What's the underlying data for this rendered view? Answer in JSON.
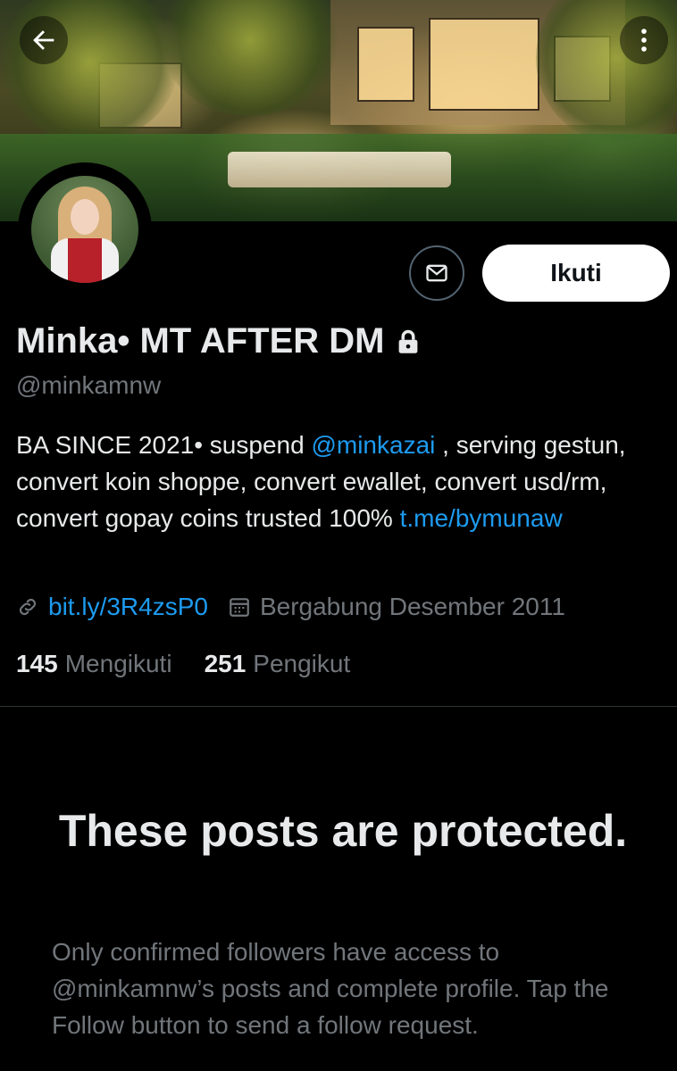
{
  "profile": {
    "display_name": "Minka• MT AFTER DM",
    "handle": "@minkamnw",
    "bio": {
      "part1": "BA SINCE 2021• suspend ",
      "mention": "@minkazai",
      "part2": " , serving gestun, convert koin shoppe, convert ewallet, convert usd/rm, convert gopay coins trusted 100% ",
      "link": "t.me/bymunaw"
    },
    "website": "bit.ly/3R4zsP0",
    "joined": "Bergabung Desember 2011",
    "following_count": "145",
    "following_label": "Mengikuti",
    "followers_count": "251",
    "followers_label": "Pengikut"
  },
  "actions": {
    "follow_label": "Ikuti"
  },
  "protected": {
    "title": "These posts are protected.",
    "description": "Only confirmed followers have access to @minkamnw’s posts and complete profile. Tap the Follow button to send a follow request."
  },
  "icons": {
    "back": "arrow-left-icon",
    "more": "more-vertical-icon",
    "message": "envelope-icon",
    "lock": "lock-icon",
    "link": "link-icon",
    "calendar": "calendar-icon"
  },
  "colors": {
    "background": "#000000",
    "accent": "#1d9bf0",
    "muted": "#71767b",
    "text": "#e7e9ea",
    "follow_button": "#ffffff"
  }
}
